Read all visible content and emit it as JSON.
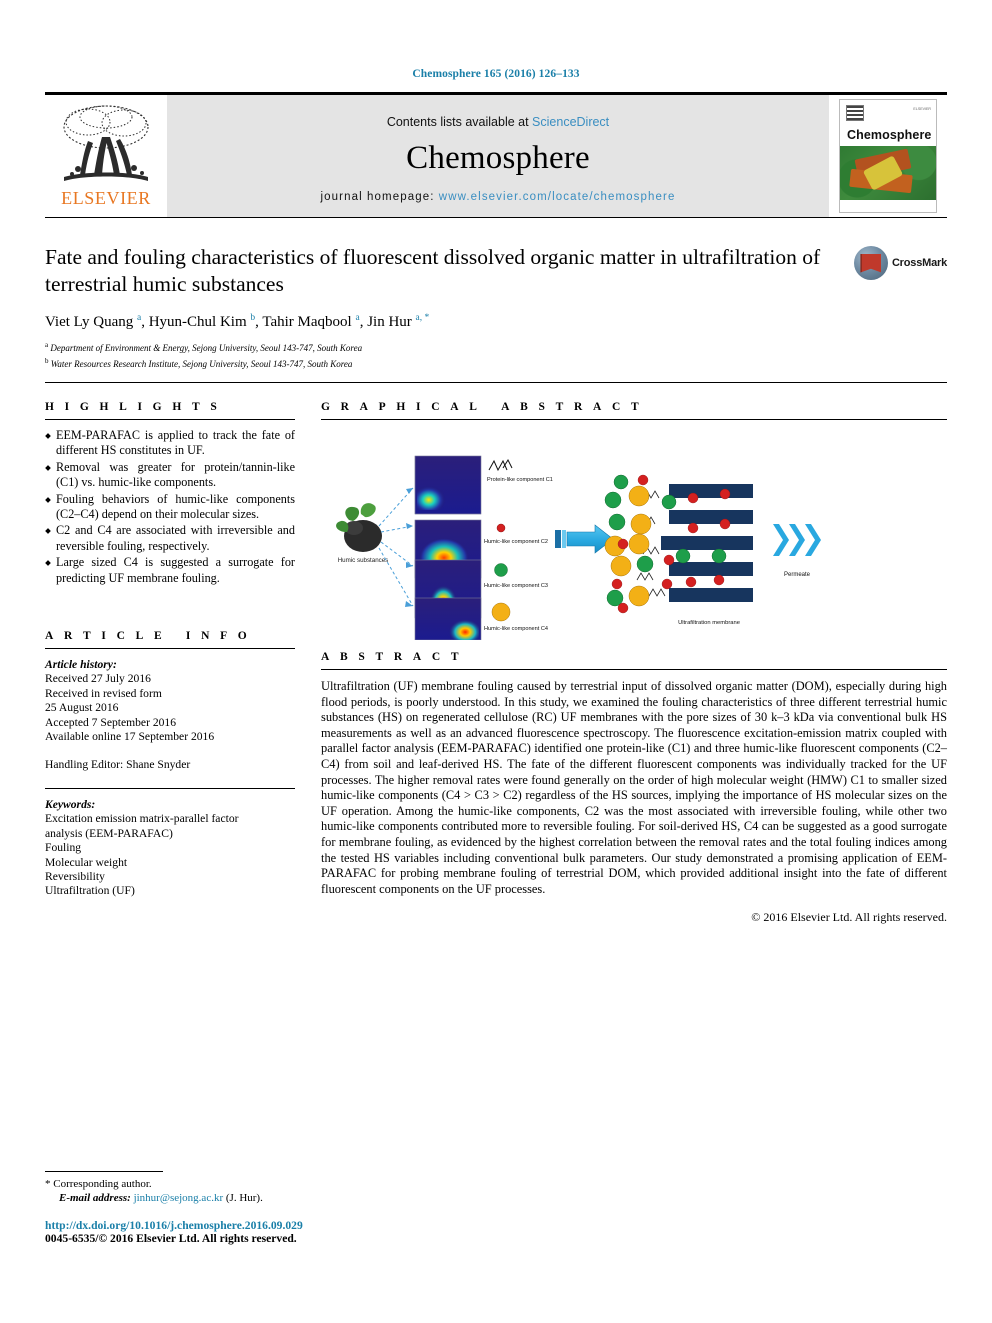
{
  "running_head": "Chemosphere 165 (2016) 126–133",
  "masthead": {
    "publisher": "ELSEVIER",
    "contents_prefix": "Contents lists available at ",
    "contents_link": "ScienceDirect",
    "journal": "Chemosphere",
    "homepage_label": "journal homepage:",
    "homepage_url": "www.elsevier.com/locate/chemosphere",
    "cover_title": "Chemosphere",
    "cover_publisher_mark": "ELSEVIER"
  },
  "article": {
    "title": "Fate and fouling characteristics of fluorescent dissolved organic matter in ultrafiltration of terrestrial humic substances",
    "authors_html": "Viet Ly Quang <sup>a</sup>, Hyun-Chul Kim <sup>b</sup>, Tahir Maqbool <sup>a</sup>, Jin Hur <sup>a, *</sup>",
    "affiliations": [
      "Department of Environment & Energy, Sejong University, Seoul 143-747, South Korea",
      "Water Resources Research Institute, Sejong University, Seoul 143-747, South Korea"
    ],
    "crossmark_label": "CrossMark"
  },
  "highlights": {
    "heading": "HIGHLIGHTS",
    "items": [
      "EEM-PARAFAC is applied to track the fate of different HS constitutes in UF.",
      "Removal was greater for protein/tannin-like (C1) vs. humic-like components.",
      "Fouling behaviors of humic-like components (C2–C4) depend on their molecular sizes.",
      "C2 and C4 are associated with irreversible and reversible fouling, respectively.",
      "Large sized C4 is suggested a surrogate for predicting UF membrane fouling."
    ]
  },
  "graphical_abstract": {
    "heading": "GRAPHICAL ABSTRACT",
    "source_label": "Humic substances",
    "component_labels": [
      "Protein-like component C1",
      "Humic-like component C2",
      "Humic-like component C3",
      "Humic-like component C4"
    ],
    "membrane_label": "Ultrafiltration membrane",
    "permeate_label": "Permeate",
    "colors": {
      "c2_marker": "#d42020",
      "c3_marker": "#1e9e4a",
      "c4_marker": "#f3b016",
      "membrane": "#17355e",
      "arrow": "#29a8e0"
    }
  },
  "article_info": {
    "heading": "ARTICLE INFO",
    "history_label": "Article history:",
    "history": [
      "Received 27 July 2016",
      "Received in revised form",
      "25 August 2016",
      "Accepted 7 September 2016",
      "Available online 17 September 2016"
    ],
    "handling_editor": "Handling Editor: Shane Snyder",
    "keywords_label": "Keywords:",
    "keywords": [
      "Excitation emission matrix-parallel factor",
      "analysis (EEM-PARAFAC)",
      "Fouling",
      "Molecular weight",
      "Reversibility",
      "Ultrafiltration (UF)"
    ]
  },
  "abstract": {
    "heading": "ABSTRACT",
    "text": "Ultrafiltration (UF) membrane fouling caused by terrestrial input of dissolved organic matter (DOM), especially during high flood periods, is poorly understood. In this study, we examined the fouling characteristics of three different terrestrial humic substances (HS) on regenerated cellulose (RC) UF membranes with the pore sizes of 30 k–3 kDa via conventional bulk HS measurements as well as an advanced fluorescence spectroscopy. The fluorescence excitation-emission matrix coupled with parallel factor analysis (EEM-PARAFAC) identified one protein-like (C1) and three humic-like fluorescent components (C2–C4) from soil and leaf-derived HS. The fate of the different fluorescent components was individually tracked for the UF processes. The higher removal rates were found generally on the order of high molecular weight (HMW) C1 to smaller sized humic-like components (C4 > C3 > C2) regardless of the HS sources, implying the importance of HS molecular sizes on the UF operation. Among the humic-like components, C2 was the most associated with irreversible fouling, while other two humic-like components contributed more to reversible fouling. For soil-derived HS, C4 can be suggested as a good surrogate for membrane fouling, as evidenced by the highest correlation between the removal rates and the total fouling indices among the tested HS variables including conventional bulk parameters. Our study demonstrated a promising application of EEM-PARAFAC for probing membrane fouling of terrestrial DOM, which provided additional insight into the fate of different fluorescent components on the UF processes.",
    "copyright": "© 2016 Elsevier Ltd. All rights reserved."
  },
  "footer": {
    "corresponding_marker": "*",
    "corresponding_label": "Corresponding author.",
    "email_label": "E-mail address:",
    "email": "jinhur@sejong.ac.kr",
    "email_suffix": "(J. Hur).",
    "doi": "http://dx.doi.org/10.1016/j.chemosphere.2016.09.029",
    "issn": "0045-6535/© 2016 Elsevier Ltd. All rights reserved."
  }
}
